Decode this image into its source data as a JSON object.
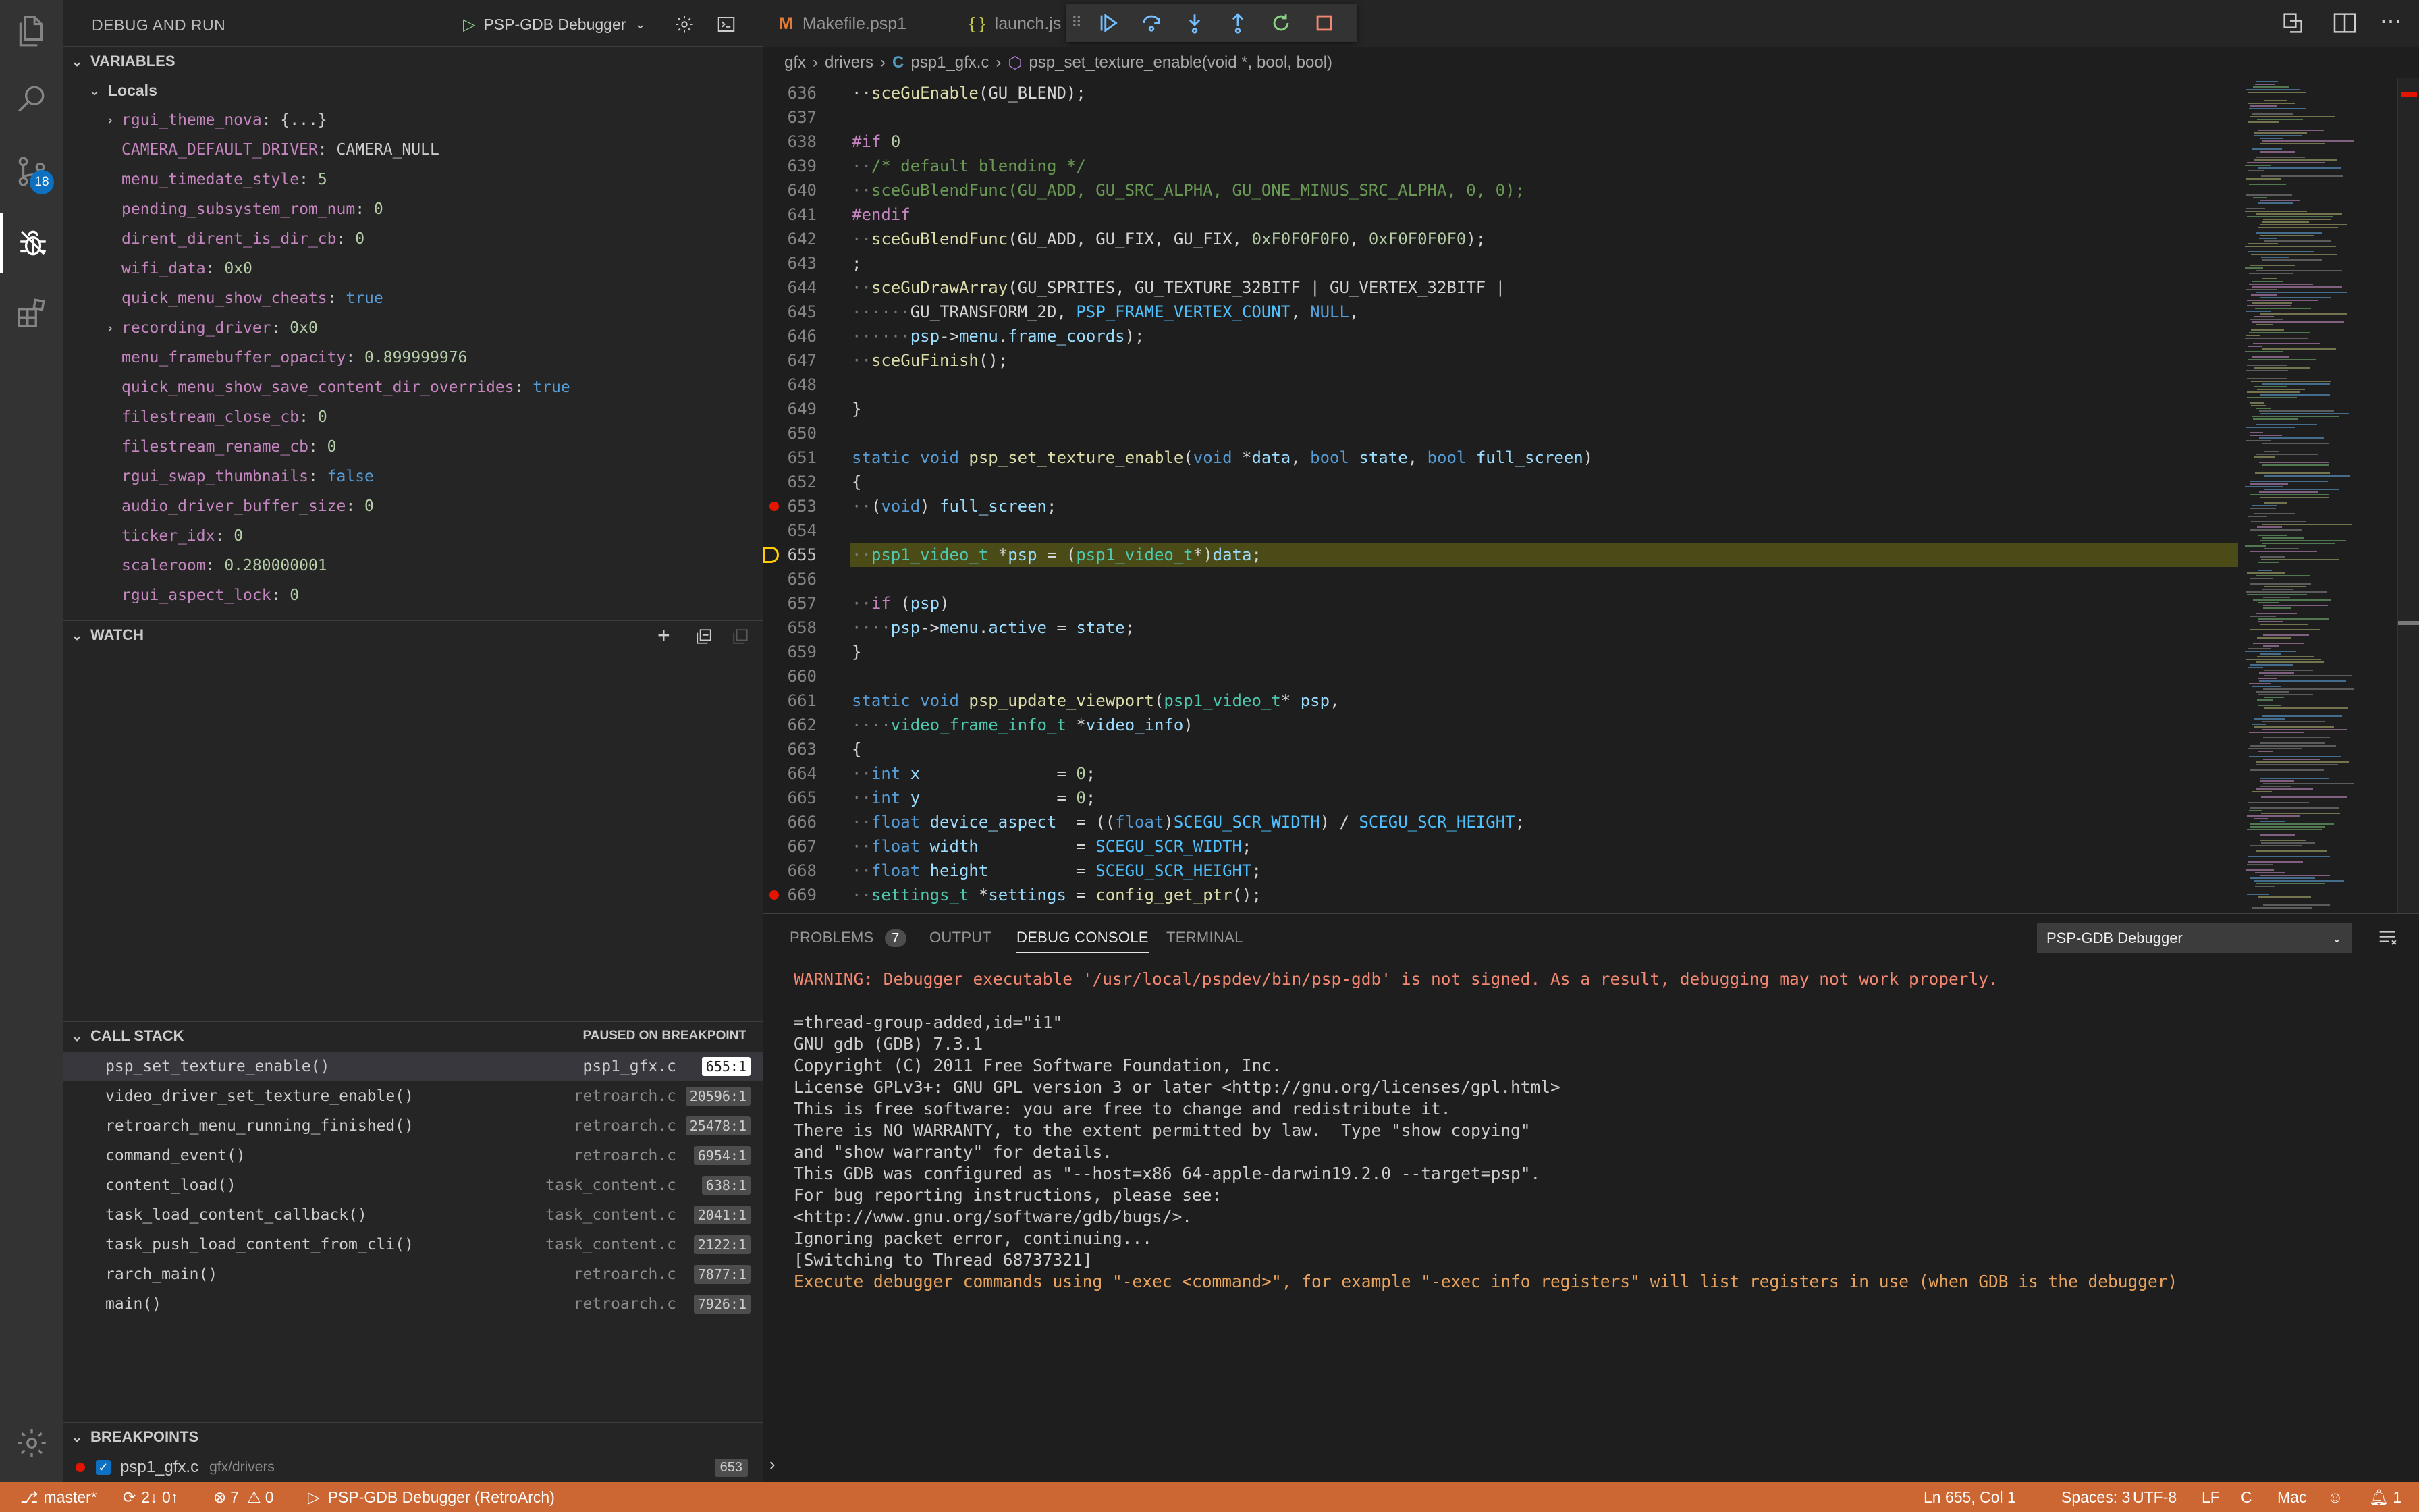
{
  "sidebar": {
    "title": "DEBUG AND RUN",
    "config": "PSP-GDB Debugger",
    "variables_header": "VARIABLES",
    "locals_label": "Locals",
    "variables": [
      {
        "name": "rgui_theme_nova",
        "value": "{...}",
        "kind": "str",
        "expandable": true
      },
      {
        "name": "CAMERA_DEFAULT_DRIVER",
        "value": "CAMERA_NULL",
        "kind": "str",
        "expandable": false
      },
      {
        "name": "menu_timedate_style",
        "value": "5",
        "kind": "num",
        "expandable": false
      },
      {
        "name": "pending_subsystem_rom_num",
        "value": "0",
        "kind": "num",
        "expandable": false
      },
      {
        "name": "dirent_dirent_is_dir_cb",
        "value": "0",
        "kind": "num",
        "expandable": false
      },
      {
        "name": "wifi_data",
        "value": "0x0",
        "kind": "num",
        "expandable": false
      },
      {
        "name": "quick_menu_show_cheats",
        "value": "true",
        "kind": "bool",
        "expandable": false
      },
      {
        "name": "recording_driver",
        "value": "0x0",
        "kind": "num",
        "expandable": true
      },
      {
        "name": "menu_framebuffer_opacity",
        "value": "0.899999976",
        "kind": "num",
        "expandable": false
      },
      {
        "name": "quick_menu_show_save_content_dir_overrides",
        "value": "true",
        "kind": "bool",
        "expandable": false
      },
      {
        "name": "filestream_close_cb",
        "value": "0",
        "kind": "num",
        "expandable": false
      },
      {
        "name": "filestream_rename_cb",
        "value": "0",
        "kind": "num",
        "expandable": false
      },
      {
        "name": "rgui_swap_thumbnails",
        "value": "false",
        "kind": "bool",
        "expandable": false
      },
      {
        "name": "audio_driver_buffer_size",
        "value": "0",
        "kind": "num",
        "expandable": false
      },
      {
        "name": "ticker_idx",
        "value": "0",
        "kind": "num",
        "expandable": false
      },
      {
        "name": "scaleroom",
        "value": "0.280000001",
        "kind": "num",
        "expandable": false
      },
      {
        "name": "rgui_aspect_lock",
        "value": "0",
        "kind": "num",
        "expandable": false
      }
    ],
    "watch_header": "WATCH",
    "callstack_header": "CALL STACK",
    "callstack_status": "PAUSED ON BREAKPOINT",
    "callstack": [
      {
        "fn": "psp_set_texture_enable()",
        "file": "psp1_gfx.c",
        "line": "655:1"
      },
      {
        "fn": "video_driver_set_texture_enable()",
        "file": "retroarch.c",
        "line": "20596:1"
      },
      {
        "fn": "retroarch_menu_running_finished()",
        "file": "retroarch.c",
        "line": "25478:1"
      },
      {
        "fn": "command_event()",
        "file": "retroarch.c",
        "line": "6954:1"
      },
      {
        "fn": "content_load()",
        "file": "task_content.c",
        "line": "638:1"
      },
      {
        "fn": "task_load_content_callback()",
        "file": "task_content.c",
        "line": "2041:1"
      },
      {
        "fn": "task_push_load_content_from_cli()",
        "file": "task_content.c",
        "line": "2122:1"
      },
      {
        "fn": "rarch_main()",
        "file": "retroarch.c",
        "line": "7877:1"
      },
      {
        "fn": "main()",
        "file": "retroarch.c",
        "line": "7926:1"
      }
    ],
    "breakpoints_header": "BREAKPOINTS",
    "breakpoint": {
      "file": "psp1_gfx.c",
      "path": "gfx/drivers",
      "line": "653"
    }
  },
  "tabs": [
    {
      "label": "Makefile.psp1",
      "icon": "M"
    },
    {
      "label": "launch.js",
      "icon": "{ }"
    }
  ],
  "breadcrumb": {
    "parts": [
      "gfx",
      "drivers",
      "psp1_gfx.c",
      "psp_set_texture_enable(void *, bool, bool)"
    ]
  },
  "editor": {
    "lines": [
      "636",
      "637",
      "638",
      "639",
      "640",
      "641",
      "642",
      "643",
      "644",
      "645",
      "646",
      "647",
      "648",
      "649",
      "650",
      "651",
      "652",
      "653",
      "654",
      "655",
      "656",
      "657",
      "658",
      "659",
      "660",
      "661",
      "662",
      "663",
      "664",
      "665",
      "666",
      "667",
      "668",
      "669"
    ],
    "current_line": "655",
    "breakpoint_lines": [
      "653",
      "669"
    ]
  },
  "panel": {
    "tabs": [
      "PROBLEMS",
      "OUTPUT",
      "DEBUG CONSOLE",
      "TERMINAL"
    ],
    "problems_count": "7",
    "selected_session": "PSP-GDB Debugger",
    "console": [
      {
        "text": "WARNING: Debugger executable '/usr/local/pspdev/bin/psp-gdb' is not signed. As a result, debugging may not work properly.",
        "style": "warn"
      },
      {
        "text": "",
        "style": "plain"
      },
      {
        "text": "=thread-group-added,id=\"i1\"",
        "style": "plain"
      },
      {
        "text": "GNU gdb (GDB) 7.3.1",
        "style": "plain"
      },
      {
        "text": "Copyright (C) 2011 Free Software Foundation, Inc.",
        "style": "plain"
      },
      {
        "text": "License GPLv3+: GNU GPL version 3 or later <http://gnu.org/licenses/gpl.html>",
        "style": "plain"
      },
      {
        "text": "This is free software: you are free to change and redistribute it.",
        "style": "plain"
      },
      {
        "text": "There is NO WARRANTY, to the extent permitted by law.  Type \"show copying\"",
        "style": "plain"
      },
      {
        "text": "and \"show warranty\" for details.",
        "style": "plain"
      },
      {
        "text": "This GDB was configured as \"--host=x86_64-apple-darwin19.2.0 --target=psp\".",
        "style": "plain"
      },
      {
        "text": "For bug reporting instructions, please see:",
        "style": "plain"
      },
      {
        "text": "<http://www.gnu.org/software/gdb/bugs/>.",
        "style": "plain"
      },
      {
        "text": "Ignoring packet error, continuing...",
        "style": "plain"
      },
      {
        "text": "[Switching to Thread 68737321]",
        "style": "plain"
      },
      {
        "text": "Execute debugger commands using \"-exec <command>\", for example \"-exec info registers\" will list registers in use (when GDB is the debugger)",
        "style": "orange"
      }
    ]
  },
  "status": {
    "branch": "master*",
    "sync": "2↓ 0↑",
    "errors": "7",
    "warnings": "0",
    "debug_session": "PSP-GDB Debugger (RetroArch)",
    "position": "Ln 655, Col 1",
    "spaces": "Spaces: 3",
    "encoding": "UTF-8",
    "eol": "LF",
    "language": "C",
    "platform": "Mac",
    "notifications": "1"
  },
  "activity": {
    "scm_badge": "18"
  }
}
